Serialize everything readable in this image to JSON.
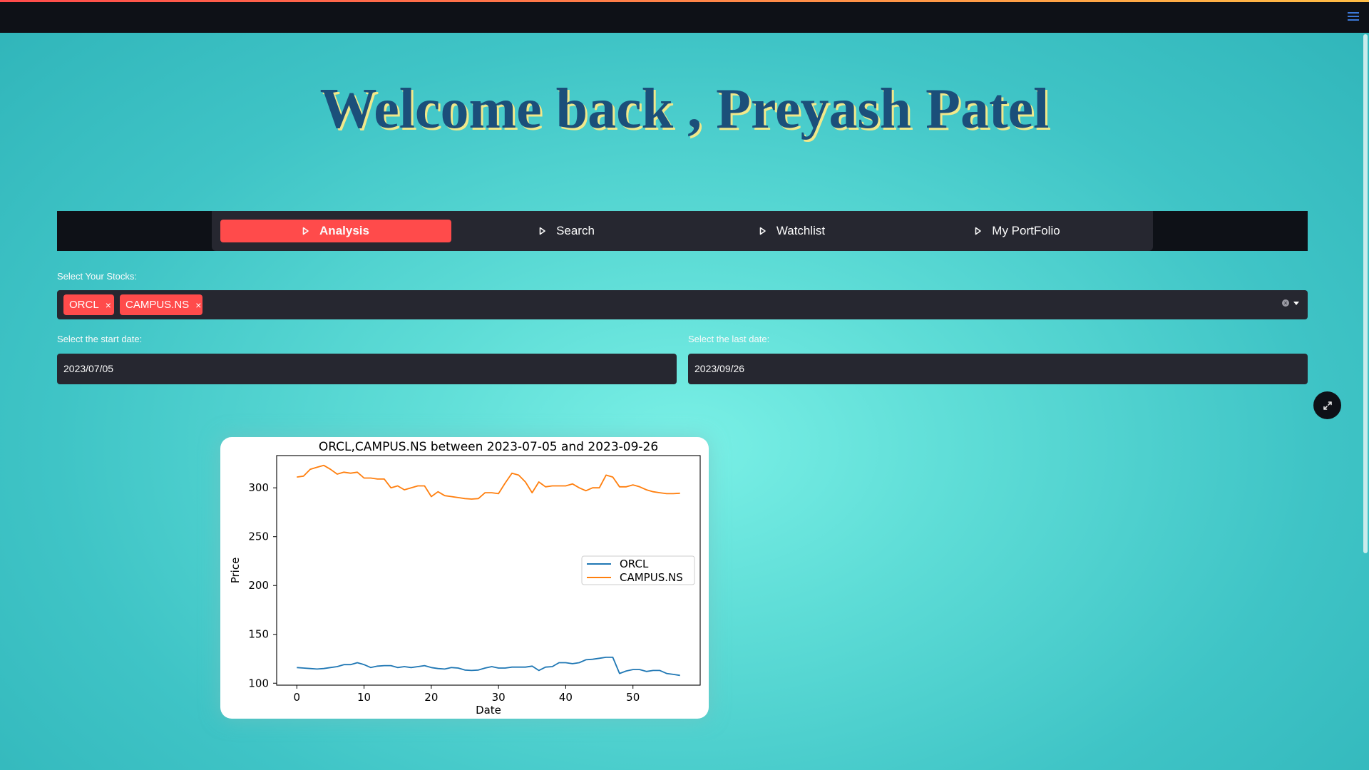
{
  "header": {
    "menu_icon": "hamburger-icon"
  },
  "title": "Welcome back , Preyash Patel",
  "nav": {
    "items": [
      {
        "label": "Analysis",
        "icon": "play-outline-icon",
        "active": true
      },
      {
        "label": "Search",
        "icon": "play-outline-icon",
        "active": false
      },
      {
        "label": "Watchlist",
        "icon": "play-outline-icon",
        "active": false
      },
      {
        "label": "My PortFolio",
        "icon": "play-outline-icon",
        "active": false
      }
    ],
    "accent": "#ff4b4b"
  },
  "stocks": {
    "label": "Select Your Stocks:",
    "selected": [
      "ORCL",
      "CAMPUS.NS"
    ],
    "remove_symbol": "×"
  },
  "dates": {
    "start_label": "Select the start date:",
    "start_value": "2023/07/05",
    "end_label": "Select the last date:",
    "end_value": "2023/09/26"
  },
  "chart_data": {
    "type": "line",
    "title": "ORCL,CAMPUS.NS between 2023-07-05 and 2023-09-26",
    "xlabel": "Date",
    "ylabel": "Price",
    "xlim": [
      -3,
      60
    ],
    "ylim": [
      98,
      333
    ],
    "xticks": [
      0,
      10,
      20,
      30,
      40,
      50
    ],
    "yticks": [
      100,
      150,
      200,
      250,
      300
    ],
    "legend_position": "center-right",
    "series": [
      {
        "name": "ORCL",
        "color": "#1f77b4",
        "x": [
          0,
          1,
          2,
          3,
          4,
          5,
          6,
          7,
          8,
          9,
          10,
          11,
          12,
          13,
          14,
          15,
          16,
          17,
          18,
          19,
          20,
          21,
          22,
          23,
          24,
          25,
          26,
          27,
          28,
          29,
          30,
          31,
          32,
          33,
          34,
          35,
          36,
          37,
          38,
          39,
          40,
          41,
          42,
          43,
          44,
          45,
          46,
          47,
          48,
          49,
          50,
          51,
          52,
          53,
          54,
          55,
          56,
          57
        ],
        "values": [
          116,
          115.5,
          115,
          114.5,
          115,
          116,
          117,
          119,
          119,
          121,
          119,
          116,
          117.5,
          118,
          118,
          116,
          117,
          116,
          117,
          118,
          116,
          115,
          114.5,
          116,
          115.5,
          113.5,
          113,
          113.5,
          115.5,
          117,
          115.5,
          115.5,
          116.5,
          116.5,
          116.5,
          117.5,
          113,
          116.5,
          117,
          121,
          121,
          120,
          121,
          124,
          124.5,
          125.5,
          126.5,
          126.5,
          110,
          112.5,
          114,
          114,
          112,
          113,
          113,
          110,
          109,
          108
        ]
      },
      {
        "name": "CAMPUS.NS",
        "color": "#ff7f0e",
        "x": [
          0,
          1,
          2,
          3,
          4,
          5,
          6,
          7,
          8,
          9,
          10,
          11,
          12,
          13,
          14,
          15,
          16,
          17,
          18,
          19,
          20,
          21,
          22,
          23,
          24,
          25,
          26,
          27,
          28,
          29,
          30,
          31,
          32,
          33,
          34,
          35,
          36,
          37,
          38,
          39,
          40,
          41,
          42,
          43,
          44,
          45,
          46,
          47,
          48,
          49,
          50,
          51,
          52,
          53,
          54,
          55,
          56,
          57
        ],
        "values": [
          311,
          312,
          319,
          321,
          323,
          319,
          314,
          316,
          315,
          316,
          310,
          310,
          309,
          309,
          300,
          302,
          298,
          300,
          302,
          302,
          291,
          296,
          292,
          291,
          290,
          289,
          288.5,
          289,
          295,
          295,
          294,
          305,
          315,
          313,
          306,
          295,
          306,
          301,
          302,
          302,
          302,
          304,
          300,
          297,
          300,
          300,
          313,
          311,
          301,
          301,
          303,
          301,
          298,
          296,
          295,
          294,
          294,
          294.5
        ]
      }
    ]
  }
}
